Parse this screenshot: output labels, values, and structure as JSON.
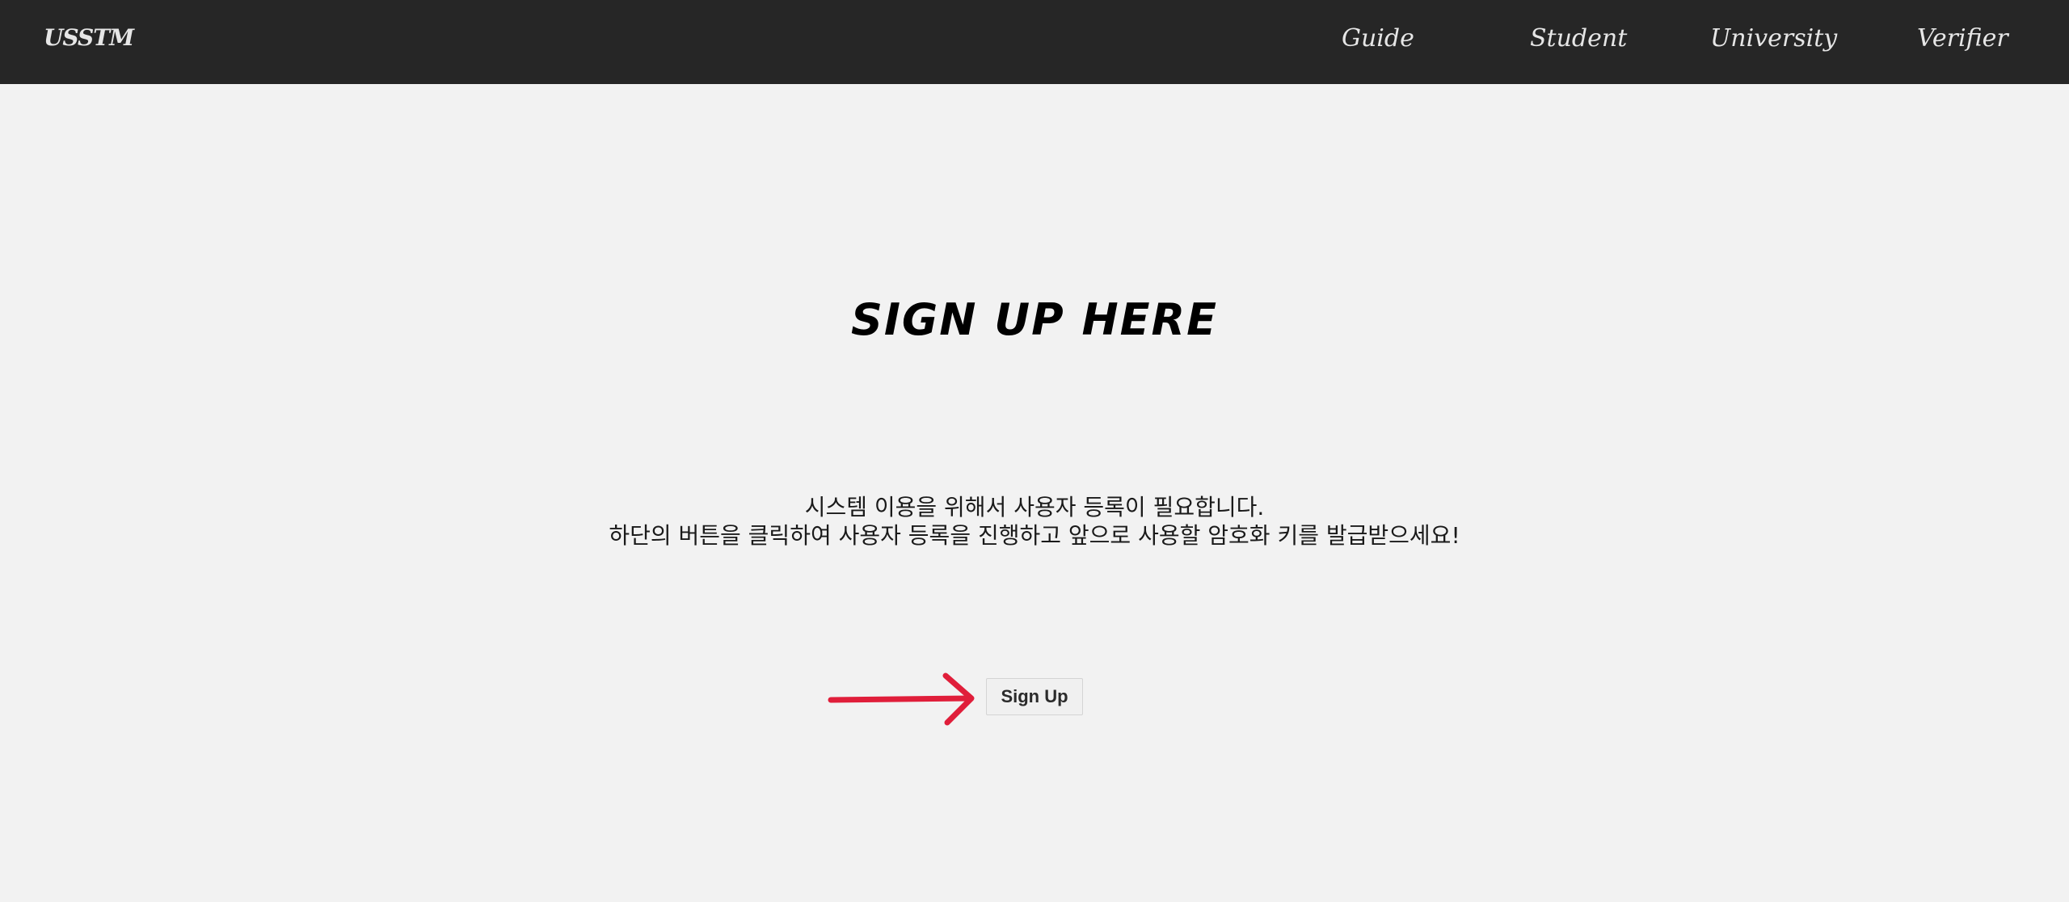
{
  "header": {
    "brand": "USSTM",
    "nav": [
      {
        "label": "Guide"
      },
      {
        "label": "Student"
      },
      {
        "label": "University"
      },
      {
        "label": "Verifier"
      }
    ]
  },
  "main": {
    "title": "SIGN UP HERE",
    "description_line1": "시스템 이용을 위해서 사용자 등록이 필요합니다.",
    "description_line2": "하단의 버튼을 클릭하여 사용자 등록을 진행하고 앞으로 사용할 암호화 키를 발급받으세요!",
    "signup_button_label": "Sign Up"
  },
  "colors": {
    "navbar_bg": "#262626",
    "page_bg": "#f2f2f2",
    "arrow": "#e01e3a"
  },
  "icons": {
    "arrow": "arrow-right-icon"
  }
}
